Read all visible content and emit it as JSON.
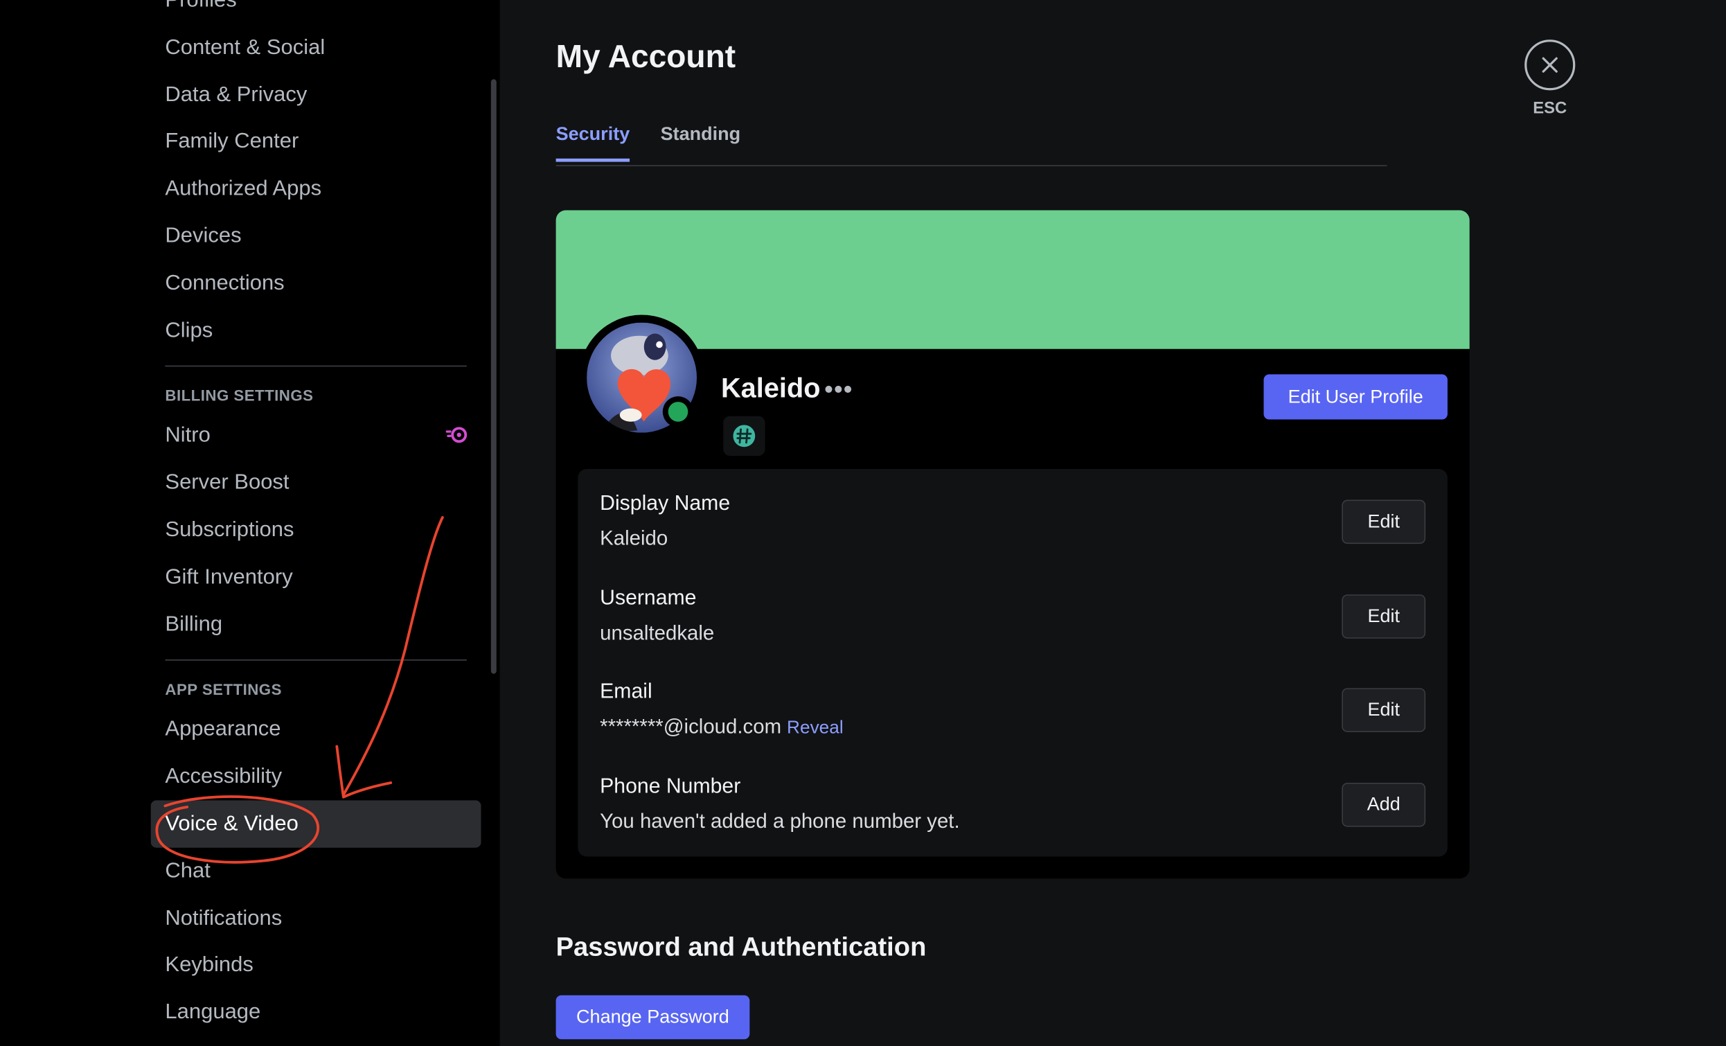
{
  "sidebar": {
    "items_top": [
      {
        "label": "Profiles"
      },
      {
        "label": "Content & Social"
      },
      {
        "label": "Data & Privacy"
      },
      {
        "label": "Family Center"
      },
      {
        "label": "Authorized Apps"
      },
      {
        "label": "Devices"
      },
      {
        "label": "Connections"
      },
      {
        "label": "Clips"
      }
    ],
    "billing_header": "BILLING SETTINGS",
    "billing_items": [
      {
        "label": "Nitro",
        "icon": "nitro-icon"
      },
      {
        "label": "Server Boost"
      },
      {
        "label": "Subscriptions"
      },
      {
        "label": "Gift Inventory"
      },
      {
        "label": "Billing"
      }
    ],
    "app_header": "APP SETTINGS",
    "app_items": [
      {
        "label": "Appearance"
      },
      {
        "label": "Accessibility"
      },
      {
        "label": "Voice & Video",
        "selected": true
      },
      {
        "label": "Chat"
      },
      {
        "label": "Notifications"
      },
      {
        "label": "Keybinds"
      },
      {
        "label": "Language"
      }
    ]
  },
  "main": {
    "title": "My Account",
    "tabs": [
      {
        "label": "Security",
        "active": true
      },
      {
        "label": "Standing",
        "active": false
      }
    ],
    "close": {
      "icon": "close-icon",
      "label": "ESC"
    },
    "profile": {
      "name": "Kaleido",
      "more_label": "•••",
      "banner_color": "#6dcf8f",
      "status": "online",
      "status_color": "#23a55a",
      "badge_icon": "hashtag-badge-icon",
      "edit_button": "Edit User Profile"
    },
    "fields": [
      {
        "label": "Display Name",
        "value": "Kaleido",
        "button": "Edit"
      },
      {
        "label": "Username",
        "value": "unsaltedkale",
        "button": "Edit"
      },
      {
        "label": "Email",
        "value": "********@icloud.com",
        "link": "Reveal",
        "button": "Edit"
      },
      {
        "label": "Phone Number",
        "value": "You haven't added a phone number yet.",
        "button": "Add"
      }
    ],
    "password_section": {
      "title": "Password and Authentication",
      "button": "Change Password"
    }
  },
  "colors": {
    "accent": "#5865f2",
    "tab_active": "#8c9eff",
    "annotation": "#e8442f"
  }
}
